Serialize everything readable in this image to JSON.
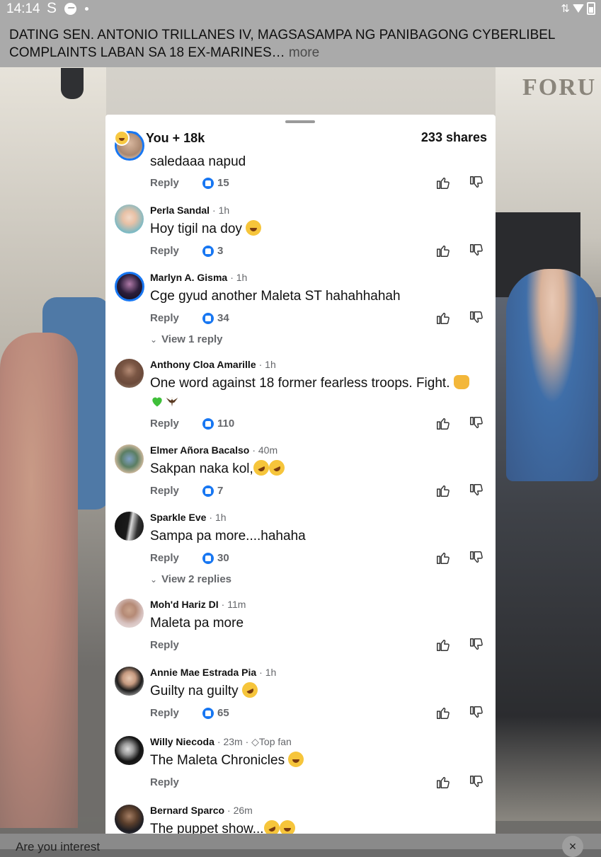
{
  "status_bar": {
    "time": "14:14",
    "s_icon": "S"
  },
  "post": {
    "headline": "DATING SEN. ANTONIO TRILLANES IV, MAGSASAMPA NG PANIBAGONG CYBERLIBEL COMPLAINTS LABAN SA 18 EX-MARINES…",
    "more_label": "more"
  },
  "background": {
    "sign_text": "FORU"
  },
  "sheet": {
    "reactions_text": "You + 18k",
    "shares_text": "233 shares",
    "reply_label": "Reply",
    "comments": [
      {
        "name": "",
        "time": "",
        "text": "saledaaa napud",
        "likes": "15"
      },
      {
        "name": "Perla Sandal",
        "time": "· 1h",
        "text": "Hoy tigil na doy",
        "likes": "3"
      },
      {
        "name": "Marlyn A. Gisma",
        "time": "· 1h",
        "text": "Cge gyud another Maleta ST hahahhahah",
        "likes": "34",
        "view_replies": "View 1 reply"
      },
      {
        "name": "Anthony Cloa Amarille",
        "time": "· 1h",
        "text": "One word against 18 former fearless troops. Fight.",
        "likes": "110"
      },
      {
        "name": "Elmer Añora Bacalso",
        "time": "· 40m",
        "text": "Sakpan naka kol,",
        "likes": "7"
      },
      {
        "name": "Sparkle Eve",
        "time": "· 1h",
        "text": "Sampa pa more....hahaha",
        "likes": "30",
        "view_replies": "View 2 replies"
      },
      {
        "name": "Moh'd Hariz DI",
        "time": "· 11m",
        "text": "Maleta pa more",
        "likes": ""
      },
      {
        "name": "Annie Mae Estrada Pia",
        "time": "· 1h",
        "text": "Guilty na guilty",
        "likes": "65"
      },
      {
        "name": "Willy Niecoda",
        "time": "· 23m ·",
        "badge": "Top fan",
        "text": "The Maleta Chronicles",
        "likes": ""
      },
      {
        "name": "Bernard Sparco",
        "time": "· 26m",
        "text": "The puppet show...",
        "likes": ""
      }
    ]
  },
  "banner": {
    "text": "Are you interest",
    "close": "×"
  }
}
